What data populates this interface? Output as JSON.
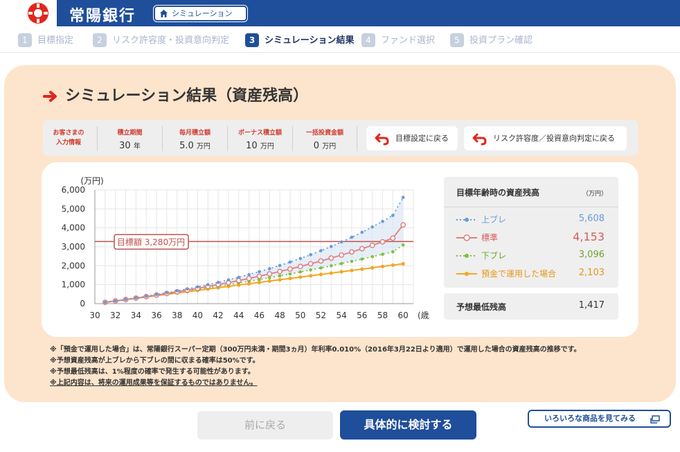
{
  "header": {
    "bank_name": "常陽銀行",
    "sim_top_label": "シミュレーションTOP"
  },
  "steps": [
    {
      "num": "1",
      "label": "目標指定",
      "active": false
    },
    {
      "num": "2",
      "label": "リスク許容度・投資意向判定",
      "active": false
    },
    {
      "num": "3",
      "label": "シミュレーション結果",
      "active": true
    },
    {
      "num": "4",
      "label": "ファンド選択",
      "active": false
    },
    {
      "num": "5",
      "label": "投資プラン確認",
      "active": false
    }
  ],
  "page_title": "シミュレーション結果（資産残高）",
  "inputs": {
    "label_line1": "お客さまの",
    "label_line2": "入力情報",
    "period": {
      "label": "積立期間",
      "value": "30",
      "unit": "年"
    },
    "monthly": {
      "label": "毎月積立額",
      "value": "5.0",
      "unit": "万円"
    },
    "bonus": {
      "label": "ボーナス積立額",
      "value": "10",
      "unit": "万円"
    },
    "lump": {
      "label": "一括投資金額",
      "value": "0",
      "unit": "万円"
    }
  },
  "buttons": {
    "back_goal": "目標設定に戻る",
    "back_risk": "リスク許容度／投資意向判定に戻る",
    "prev": "前に戻る",
    "next": "具体的に検討する",
    "other_products": "いろいろな商品を見てみる"
  },
  "legend": {
    "heading": "目標年齢時の資産残高",
    "unit": "（万円）",
    "rows": [
      {
        "name": "上ブレ",
        "value": "5,608",
        "color": "#6a9ad6"
      },
      {
        "name": "標準",
        "value": "4,153",
        "color": "#e07f7f"
      },
      {
        "name": "下ブレ",
        "value": "3,096",
        "color": "#7fbf3f"
      },
      {
        "name": "預金で運用した場合",
        "value": "2,103",
        "color": "#f5a623"
      }
    ],
    "min_label": "予想最低残高",
    "min_value": "1,417"
  },
  "notes": [
    "※「預金で運用した場合」は、常陽銀行スーパー定期（300万円未満・期間3ヵ月）年利率0.010%（2016年3月22日より適用）で運用した場合の資産残高の推移です。",
    "※予想資産残高が上ブレから下ブレの間に収まる確率は50%です。",
    "※予想最低残高は、1%程度の確率で発生する可能性があります。",
    "※上記内容は、将来の運用成果等を保証するものではありません。"
  ],
  "chart_data": {
    "type": "line",
    "title": "",
    "ylabel": "(万円)",
    "xlabel": "(歳)",
    "ylim": [
      0,
      6000
    ],
    "xlim": [
      30,
      61
    ],
    "yticks": [
      0,
      1000,
      2000,
      3000,
      4000,
      5000,
      6000
    ],
    "ytick_labels": [
      "0",
      "1,000",
      "2,000",
      "3,000",
      "4,000",
      "5,000",
      "6,000"
    ],
    "xticks": [
      30,
      32,
      34,
      36,
      38,
      40,
      42,
      44,
      46,
      48,
      50,
      52,
      54,
      56,
      58,
      60
    ],
    "x": [
      31,
      32,
      33,
      34,
      35,
      36,
      37,
      38,
      39,
      40,
      41,
      42,
      43,
      44,
      45,
      46,
      47,
      48,
      49,
      50,
      51,
      52,
      53,
      54,
      55,
      56,
      57,
      58,
      59,
      60
    ],
    "target": {
      "label": "目標額 3,280万円",
      "value": 3280
    },
    "series": [
      {
        "name": "上ブレ",
        "color": "#6a9ad6",
        "values": [
          70,
          145,
          223,
          305,
          390,
          480,
          574,
          673,
          777,
          887,
          1003,
          1125,
          1254,
          1390,
          1534,
          1686,
          1846,
          2015,
          2194,
          2383,
          2583,
          2794,
          3017,
          3253,
          3503,
          3767,
          4046,
          4342,
          4655,
          5608
        ]
      },
      {
        "name": "標準",
        "color": "#e07f7f",
        "values": [
          70,
          142,
          216,
          292,
          371,
          453,
          537,
          624,
          714,
          808,
          905,
          1006,
          1110,
          1219,
          1331,
          1448,
          1570,
          1696,
          1827,
          1963,
          2104,
          2251,
          2404,
          2563,
          2728,
          2900,
          3078,
          3264,
          3458,
          4153
        ]
      },
      {
        "name": "下ブレ",
        "color": "#7fbf3f",
        "values": [
          70,
          140,
          211,
          283,
          356,
          431,
          507,
          585,
          664,
          745,
          828,
          913,
          1000,
          1089,
          1180,
          1273,
          1369,
          1467,
          1568,
          1672,
          1778,
          1887,
          1999,
          2114,
          2232,
          2353,
          2478,
          2606,
          2737,
          3096
        ]
      },
      {
        "name": "預金で運用した場合",
        "color": "#f5a623",
        "values": [
          70,
          140,
          210,
          280,
          350,
          420,
          490,
          560,
          630,
          700,
          770,
          841,
          911,
          981,
          1051,
          1121,
          1191,
          1261,
          1331,
          1401,
          1472,
          1542,
          1612,
          1682,
          1752,
          1822,
          1892,
          1963,
          2033,
          2103
        ]
      }
    ]
  }
}
